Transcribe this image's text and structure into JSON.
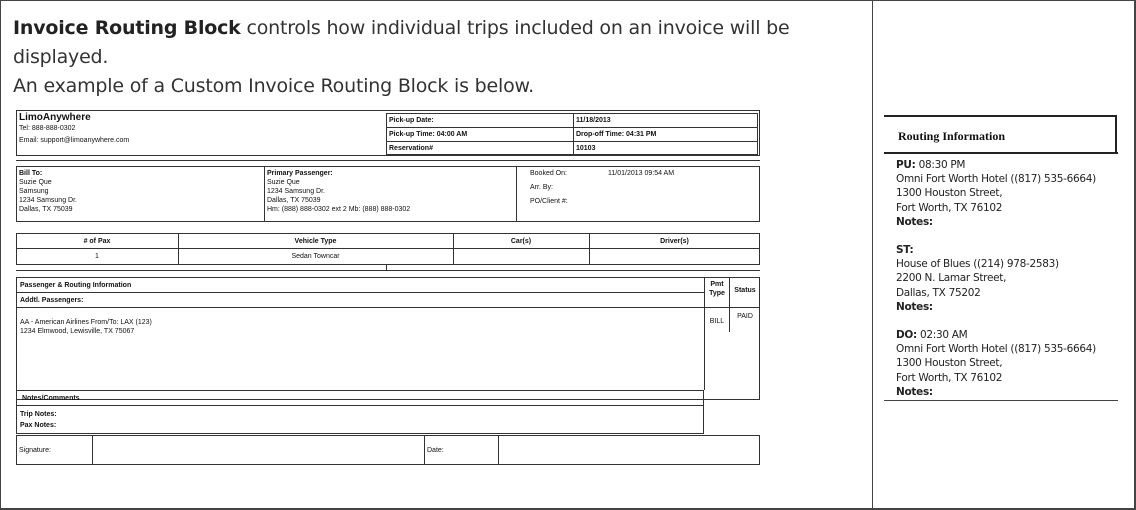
{
  "intro": {
    "bold_term": "Invoice Routing Block",
    "sentence1_rest": " controls how individual trips included on an invoice will be displayed.",
    "sentence2": "An example of a Custom Invoice Routing Block is below."
  },
  "invoice": {
    "company": "LimoAnywhere",
    "tel": "Tel: 888-888-0302",
    "email": "Email: support@limoanywhere.com",
    "pickup_date_label": "Pick-up Date:",
    "pickup_date_value": "11/18/2013",
    "pickup_time_label": "Pick-up Time: 04:00 AM",
    "dropoff_time_label": "Drop-off Time: 04:31 PM",
    "reservation_label": "Reservation#",
    "reservation_value": "10103",
    "bill_to_label": "Bill To:",
    "bill_to_lines": [
      "Suzie Que",
      "Samsung",
      "1234 Samsung Dr.",
      "Dallas, TX 75039"
    ],
    "primary_label": "Primary Passenger:",
    "primary_lines": [
      "Suzie Que",
      "1234 Samsung Dr.",
      "Dallas, TX 75039",
      "Hm: (888) 888-0302 ext 2 Mb: (888) 888-0302"
    ],
    "booked_on_label": "Booked On:",
    "booked_on_value": "11/01/2013 09:54 AM",
    "arr_by_label": "Arr. By:",
    "po_label": "PO/Client #:",
    "table_headers": [
      "# of Pax",
      "Vehicle Type",
      "Car(s)",
      "Driver(s)"
    ],
    "table_row": [
      "1",
      "Sedan Towncar",
      "",
      ""
    ],
    "routing_label": "Passenger & Routing Information",
    "addtl_label": "Addtl. Passengers:",
    "pmt_type_label": "Pmt Type",
    "status_label": "Status",
    "pmt_type_value": "BILL",
    "status_value": "PAID",
    "route_lines": [
      "AA - American Airlines From/To: LAX (123)",
      "1234 Elmwood, Lewisville, TX 75067"
    ],
    "notes_label": "Notes/Comments",
    "trip_notes_label": "Trip Notes:",
    "pax_notes_label": "Pax Notes:",
    "signature_label": "Signature:",
    "date_label": "Date:"
  },
  "routing_info": {
    "title": "Routing Information",
    "sections": [
      {
        "label": "PU:",
        "time": " 08:30 PM",
        "lines": [
          "Omni Fort Worth Hotel ((817) 535-6664)",
          "1300 Houston Street,",
          "Fort Worth, TX 76102"
        ],
        "notes": "Notes:"
      },
      {
        "label": "ST:",
        "time": "",
        "lines": [
          "House of Blues ((214) 978-2583)",
          "2200 N. Lamar Street,",
          "Dallas, TX 75202"
        ],
        "notes": "Notes:"
      },
      {
        "label": "DO:",
        "time": " 02:30 AM",
        "lines": [
          "Omni Fort Worth Hotel ((817) 535-6664)",
          "1300 Houston Street,",
          "Fort Worth, TX 76102"
        ],
        "notes": "Notes:"
      }
    ]
  }
}
